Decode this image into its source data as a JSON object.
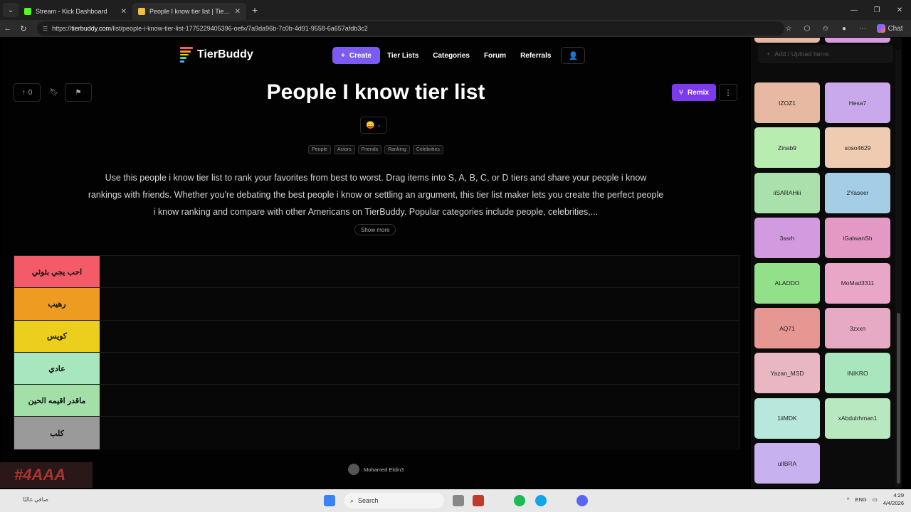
{
  "browser": {
    "tabs": [
      {
        "title": "Stream - Kick Dashboard",
        "active": false,
        "favicon_color": "#53fc18"
      },
      {
        "title": "People I know tier list | TierBuddy",
        "active": true,
        "favicon_color": "#f0c040"
      }
    ],
    "new_tab": "+",
    "url": {
      "protocol": "https://",
      "host": "tierbuddy.com",
      "path": "/list/people-i-know-tier-list-1775229405396-oefx/7a9da96b-7c0b-4d91-9558-6a657afdb3c2"
    },
    "chat_label": "Chat"
  },
  "header": {
    "logo_text": "TierBuddy",
    "create_label": "Create",
    "nav": [
      "Tier Lists",
      "Categories",
      "Forum",
      "Referrals"
    ]
  },
  "list": {
    "upvotes": "0",
    "title": "People I know tier list",
    "remix_label": "Remix",
    "emoji": "😛",
    "tags": [
      "People",
      "Actors",
      "Friends",
      "Ranking",
      "Celebrities"
    ],
    "description": "Use this people i know tier list to rank your favorites from best to worst. Drag items into S, A, B, C, or D tiers and share your people i know rankings with friends. Whether you're debating the best people i know or settling an argument, this tier list maker lets you create the perfect people i know ranking and compare with other Americans on TierBuddy. Popular categories include people, celebrities,...",
    "show_more": "Show more",
    "author": "Mohamed Eldin3"
  },
  "tiers": [
    {
      "label": "احب يجي بثوثي",
      "color": "#f45b69"
    },
    {
      "label": "رهيب",
      "color": "#ee9b22"
    },
    {
      "label": "كويس",
      "color": "#eccf1c"
    },
    {
      "label": "عادي",
      "color": "#a8e6c0"
    },
    {
      "label": "ماقدر اقيمه الحين",
      "color": "#a3e0a8"
    },
    {
      "label": "كلب",
      "color": "#9a9a9a"
    }
  ],
  "panel": {
    "upload_label": "Add / Upload Items",
    "items": [
      {
        "name": "",
        "color": "#e7b9a3"
      },
      {
        "name": "",
        "color": "#d79ae0"
      },
      {
        "name": "IZOZ1",
        "color": "#e7b9a3"
      },
      {
        "name": "Hesa7",
        "color": "#c9a9ec"
      },
      {
        "name": "Zinab9",
        "color": "#b8ecb0"
      },
      {
        "name": "soso4629",
        "color": "#efcbb2"
      },
      {
        "name": "iiSARAHiii",
        "color": "#a9e0ab"
      },
      {
        "name": "2Yaseer",
        "color": "#a4cde6"
      },
      {
        "name": "3ssrh",
        "color": "#d29be0"
      },
      {
        "name": "iGalwanSh",
        "color": "#e399c4"
      },
      {
        "name": "ALADDO",
        "color": "#92e18a"
      },
      {
        "name": "MoMad3311",
        "color": "#e9a6c6"
      },
      {
        "name": "AQ71",
        "color": "#e69792"
      },
      {
        "name": "3zxxn",
        "color": "#e7aac5"
      },
      {
        "name": "Yazan_MSD",
        "color": "#e9b7c4"
      },
      {
        "name": "INIKRO",
        "color": "#a9e6be"
      },
      {
        "name": "1iiMDK",
        "color": "#b7e8db"
      },
      {
        "name": "xAbdulrhman1",
        "color": "#b8e8c0"
      },
      {
        "name": "ulIBRA",
        "color": "#c7b2ef"
      }
    ]
  },
  "overlay_text": "#4AAA",
  "taskbar": {
    "search_label": "Search",
    "weather": "صافي غالبًا",
    "lang": "ENG",
    "time": "4:29",
    "date": "4/4/2026"
  }
}
